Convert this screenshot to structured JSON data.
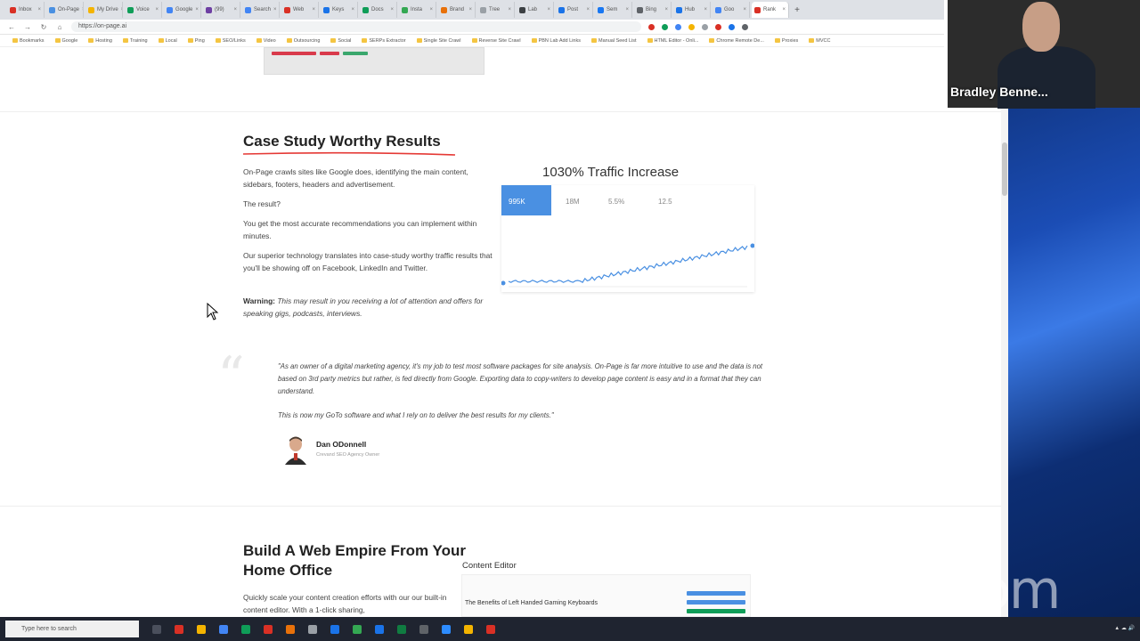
{
  "browser": {
    "tabs": [
      {
        "label": "Inbox",
        "color": "#d93025"
      },
      {
        "label": "On-Page",
        "color": "#4a90e2"
      },
      {
        "label": "My Drive",
        "color": "#f4b400"
      },
      {
        "label": "Voice",
        "color": "#0f9d58"
      },
      {
        "label": "Google",
        "color": "#4285f4"
      },
      {
        "label": "(99)",
        "color": "#6e3fa3"
      },
      {
        "label": "Search",
        "color": "#4285f4"
      },
      {
        "label": "Web",
        "color": "#d93025"
      },
      {
        "label": "Keys",
        "color": "#1a73e8"
      },
      {
        "label": "Docs",
        "color": "#0f9d58"
      },
      {
        "label": "Insta",
        "color": "#34a853"
      },
      {
        "label": "Brand",
        "color": "#e8710a"
      },
      {
        "label": "Tree",
        "color": "#9aa0a6"
      },
      {
        "label": "Lab",
        "color": "#3c4043"
      },
      {
        "label": "Post",
        "color": "#1a73e8"
      },
      {
        "label": "Sem",
        "color": "#1877f2"
      },
      {
        "label": "Bing",
        "color": "#5f6368"
      },
      {
        "label": "Hub",
        "color": "#1a73e8"
      },
      {
        "label": "Goo",
        "color": "#4285f4"
      },
      {
        "label": "Rank",
        "color": "#d93025"
      }
    ],
    "url": "https://on-page.ai",
    "bookmarks": [
      "Bookmarks",
      "Google",
      "Hosting",
      "Training",
      "Local",
      "Ping",
      "SEO/Links",
      "Video",
      "Outsourcing",
      "Social",
      "SERPs Extractor",
      "Single Site Crawl",
      "Reverse Site Crawl",
      "PBN Lab Add Links",
      "Manual Seed List",
      "HTML Editor - Onli...",
      "Chrome Remote De...",
      "Proxies",
      "MVCC"
    ]
  },
  "case_study": {
    "title": "Case Study Worthy Results",
    "p1": "On-Page crawls sites like Google does, identifying the main content, sidebars, footers, headers and advertisement.",
    "p2": "The result?",
    "p3": "You get the most accurate recommendations you can implement within minutes.",
    "p4": "Our superior technology translates into case-study worthy traffic results that you'll be showing off on Facebook, LinkedIn and Twitter.",
    "warning_label": "Warning:",
    "warning_text": "This may result in you receiving a lot of attention and offers for speaking gigs, podcasts, interviews."
  },
  "traffic": {
    "title": "1030% Traffic Increase",
    "metrics": [
      "995K",
      "18M",
      "5.5%",
      "12.5"
    ],
    "accent": "#4a90e2"
  },
  "testimonial": {
    "quote1": "\"As an owner of a digital marketing agency, it's my job to test most software packages for site analysis. On-Page is far more intuitive to use and the data is not based on 3rd party metrics but rather, is fed directly from Google. Exporting data to copy-writers to develop page content is easy and in a format that they can understand.",
    "quote2": "This is now my GoTo software and what I rely on to deliver the best results for my clients.\"",
    "author": "Dan ODonnell",
    "role": "Crevand SEO Agency Owner"
  },
  "empire": {
    "title": "Build A Web Empire From Your Home Office",
    "text": "Quickly scale your content creation efforts with our our built-in content editor.  With a 1-click sharing,",
    "editor_title": "Content Editor",
    "editor_heading": "The Benefits of Left Handed Gaming Keyboards"
  },
  "zoom": {
    "participant": "Bradley Benne...",
    "logo": "zoom"
  },
  "taskbar": {
    "search_placeholder": "Type here to search"
  }
}
